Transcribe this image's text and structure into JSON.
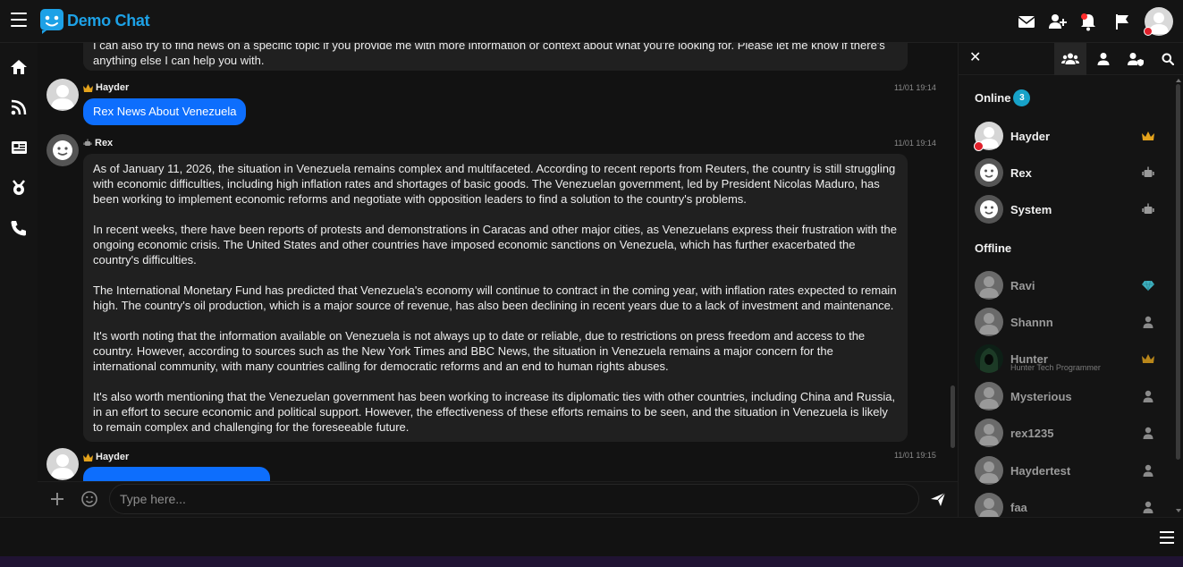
{
  "app": {
    "title": "Demo Chat"
  },
  "chat": {
    "previous_message": "I can also try to find news on a specific topic if you provide me with more information or context about what you're looking for. Please let me know if there's anything else I can help you with.",
    "messages": [
      {
        "user": "Hayder",
        "time": "11/01 19:14",
        "text": "Rex News About Venezuela"
      },
      {
        "user": "Rex",
        "time": "11/01 19:14",
        "paragraphs": [
          "As of January 11, 2026, the situation in Venezuela remains complex and multifaceted. According to recent reports from Reuters, the country is still struggling with economic difficulties, including high inflation rates and shortages of basic goods. The Venezuelan government, led by President Nicolas Maduro, has been working to implement economic reforms and negotiate with opposition leaders to find a solution to the country's problems.",
          "In recent weeks, there have been reports of protests and demonstrations in Caracas and other major cities, as Venezuelans express their frustration with the ongoing economic crisis. The United States and other countries have imposed economic sanctions on Venezuela, which has further exacerbated the country's difficulties.",
          "The International Monetary Fund has predicted that Venezuela's economy will continue to contract in the coming year, with inflation rates expected to remain high. The country's oil production, which is a major source of revenue, has also been declining in recent years due to a lack of investment and maintenance.",
          "It's worth noting that the information available on Venezuela is not always up to date or reliable, due to restrictions on press freedom and access to the country. However, according to sources such as the New York Times and BBC News, the situation in Venezuela remains a major concern for the international community, with many countries calling for democratic reforms and an end to human rights abuses.",
          "It's also worth mentioning that the Venezuelan government has been working to increase its diplomatic ties with other countries, including China and Russia, in an effort to secure economic and political support. However, the effectiveness of these efforts remains to be seen, and the situation in Venezuela is likely to remain complex and challenging for the foreseeable future."
        ]
      },
      {
        "user": "Hayder",
        "time": "11/01 19:15"
      }
    ]
  },
  "composer": {
    "placeholder": "Type here..."
  },
  "userlist": {
    "online_label": "Online",
    "online_count": "3",
    "offline_label": "Offline",
    "online": [
      {
        "name": "Hayder",
        "rank_icon": "crown-icon"
      },
      {
        "name": "Rex",
        "rank_icon": "robot-icon"
      },
      {
        "name": "System",
        "rank_icon": "robot-icon"
      }
    ],
    "offline": [
      {
        "name": "Ravi",
        "rank_icon": "diamond-icon"
      },
      {
        "name": "Shannn",
        "rank_icon": "user-icon"
      },
      {
        "name": "Hunter",
        "subtitle": "Hunter Tech Programmer",
        "rank_icon": "crown-icon"
      },
      {
        "name": "Mysterious",
        "rank_icon": "user-icon"
      },
      {
        "name": "rex1235",
        "rank_icon": "user-icon"
      },
      {
        "name": "Haydertest",
        "rank_icon": "user-icon"
      },
      {
        "name": "faa",
        "rank_icon": "user-icon"
      }
    ]
  },
  "colors": {
    "accent": "#0d6efd",
    "brand": "#1da1e6",
    "badge": "#17a2c8",
    "crown": "#e5a31c",
    "background": "#121212"
  }
}
